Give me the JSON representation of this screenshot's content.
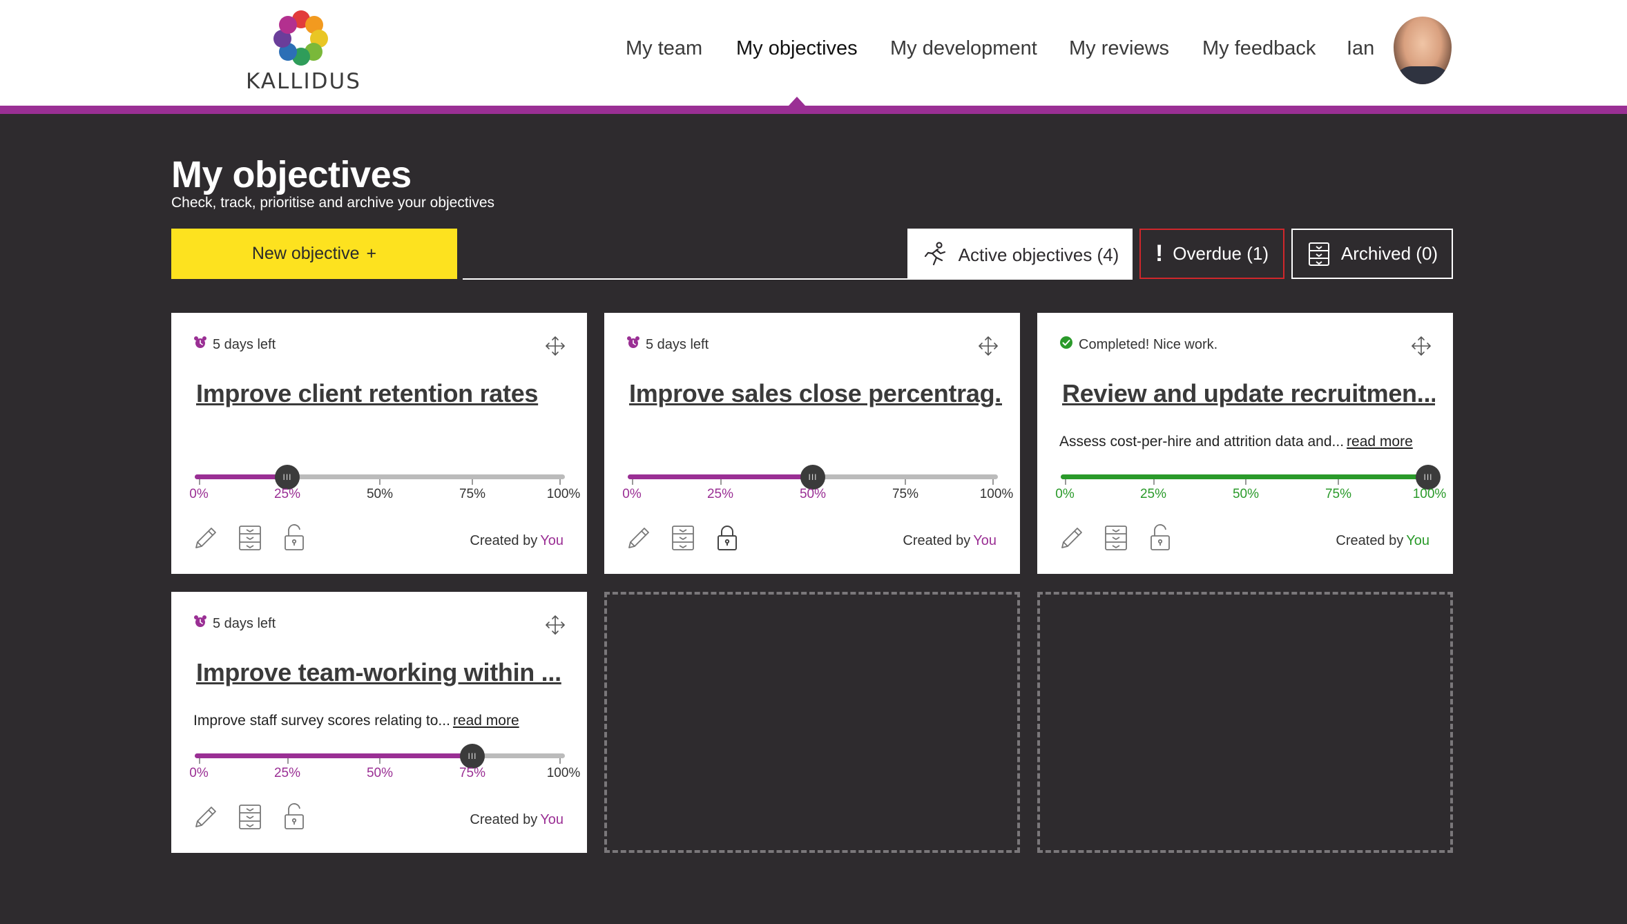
{
  "brand": {
    "name": "KALLIDUS"
  },
  "nav": {
    "items": [
      "My team",
      "My objectives",
      "My development",
      "My reviews",
      "My feedback"
    ],
    "active": "My objectives",
    "user_name": "Ian"
  },
  "page": {
    "title": "My objectives",
    "subtitle": "Check, track, prioritise and archive your objectives"
  },
  "toolbar": {
    "new_label": "New objective",
    "new_plus": "+",
    "tabs": [
      {
        "label": "Active objectives (4)",
        "icon": "running-person-icon"
      },
      {
        "label": "Overdue (1)",
        "icon": "exclamation-icon"
      },
      {
        "label": "Archived (0)",
        "icon": "archive-drawer-icon"
      }
    ]
  },
  "colors": {
    "brand_purple": "#9a2f94",
    "accent_yellow": "#fde21f",
    "complete_green": "#2a9a2a",
    "overdue_red": "#d0272b",
    "page_bg": "#2e2b2e"
  },
  "progress_labels": [
    "0%",
    "25%",
    "50%",
    "75%",
    "100%"
  ],
  "cards": [
    {
      "status": "5 days left",
      "status_icon": "alarm-clock-icon",
      "title": "Improve client retention rates",
      "description": "",
      "read_more": "",
      "progress": 0.25,
      "theme": "purple",
      "created_prefix": "Created by",
      "created_by": "You",
      "lock_icon": "padlock-open-icon"
    },
    {
      "status": "5 days left",
      "status_icon": "alarm-clock-icon",
      "title": "Improve sales close percentrag...",
      "description": "",
      "read_more": "",
      "progress": 0.5,
      "theme": "purple",
      "created_prefix": "Created by",
      "created_by": "You",
      "lock_icon": "padlock-closed-icon"
    },
    {
      "status": "Completed! Nice work.",
      "status_icon": "check-circle-icon",
      "title": "Review and update recruitmen...",
      "description": "Assess cost-per-hire and attrition data and...",
      "read_more": "read more",
      "progress": 1.0,
      "theme": "green",
      "created_prefix": "Created by",
      "created_by": "You",
      "lock_icon": "padlock-open-icon"
    },
    {
      "status": "5 days left",
      "status_icon": "alarm-clock-icon",
      "title": "Improve team-working within ...",
      "description": "Improve staff survey scores relating to...",
      "read_more": "read more",
      "progress": 0.75,
      "theme": "purple",
      "created_prefix": "Created by",
      "created_by": "You",
      "lock_icon": "padlock-open-icon"
    }
  ]
}
